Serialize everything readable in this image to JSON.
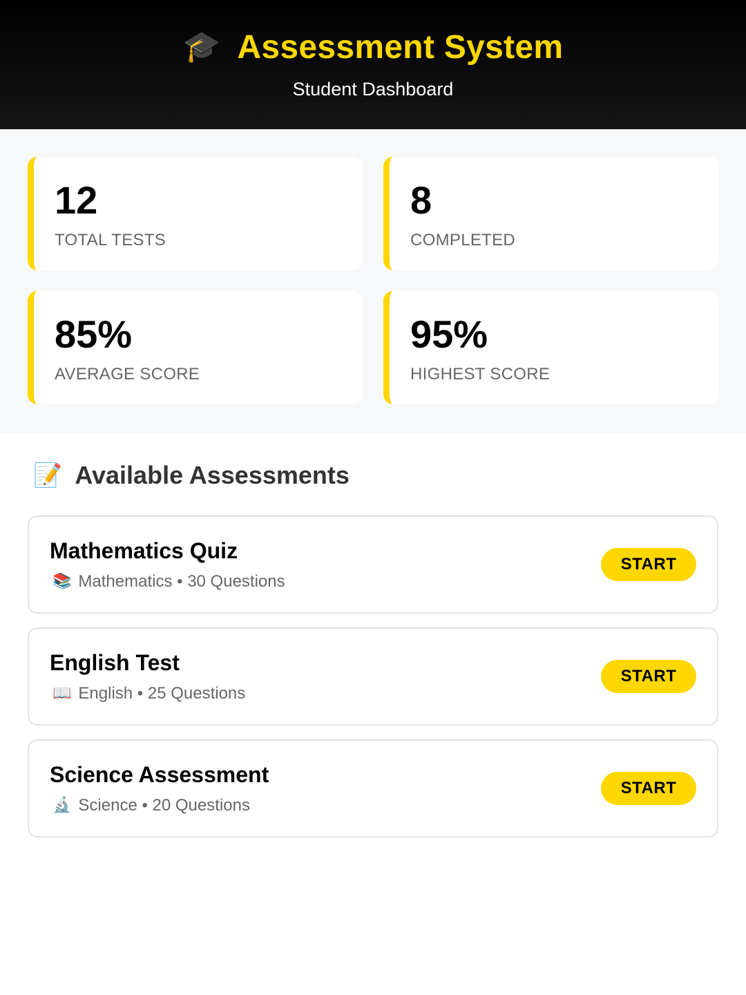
{
  "header": {
    "icon": "🎓",
    "icon_name": "graduation-cap-icon",
    "title": "Assessment System",
    "subtitle": "Student Dashboard"
  },
  "stats": [
    {
      "value": "12",
      "label": "TOTAL TESTS"
    },
    {
      "value": "8",
      "label": "COMPLETED"
    },
    {
      "value": "85%",
      "label": "AVERAGE SCORE"
    },
    {
      "value": "95%",
      "label": "HIGHEST SCORE"
    }
  ],
  "assessments_section": {
    "icon": "📝",
    "icon_name": "memo-icon",
    "title": "Available Assessments"
  },
  "assessments": [
    {
      "name": "Mathematics Quiz",
      "icon": "📚",
      "icon_name": "books-icon",
      "meta": "Mathematics • 30 Questions",
      "button": "START"
    },
    {
      "name": "English Test",
      "icon": "📖",
      "icon_name": "open-book-icon",
      "meta": "English • 25 Questions",
      "button": "START"
    },
    {
      "name": "Science Assessment",
      "icon": "🔬",
      "icon_name": "microscope-icon",
      "meta": "Science • 20 Questions",
      "button": "START"
    }
  ],
  "colors": {
    "accent": "#FFD700",
    "header_bg": "#000000",
    "stats_bg": "#F7F8FA"
  }
}
